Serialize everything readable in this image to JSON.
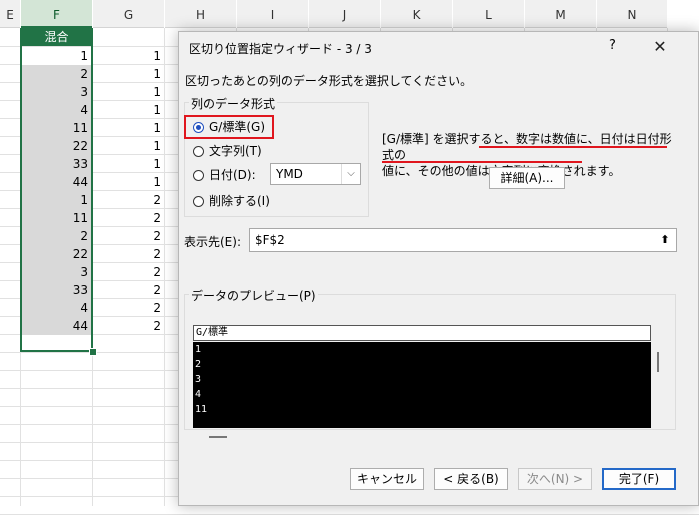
{
  "sheet": {
    "columns": [
      "E",
      "F",
      "G",
      "H",
      "I",
      "J",
      "K",
      "L",
      "M",
      "N"
    ],
    "f_header": "混合",
    "f_values": [
      "1",
      "2",
      "3",
      "4",
      "11",
      "22",
      "33",
      "44",
      "1",
      "11",
      "2",
      "22",
      "3",
      "33",
      "4",
      "44"
    ],
    "g_values": [
      "1",
      "1",
      "1",
      "1",
      "1",
      "1",
      "1",
      "1",
      "2",
      "2",
      "2",
      "2",
      "2",
      "2",
      "2",
      "2"
    ]
  },
  "dialog": {
    "title": "区切り位置指定ウィザード - 3 / 3",
    "help": "?",
    "close": "✕",
    "instruction": "区切ったあとの列のデータ形式を選択してください。",
    "format_group_label": "列のデータ形式",
    "options": [
      {
        "label": "G/標準(G)",
        "selected": true
      },
      {
        "label": "文字列(T)",
        "selected": false
      },
      {
        "label": "日付(D):",
        "selected": false
      },
      {
        "label": "削除する(I)",
        "selected": false
      }
    ],
    "date_format": "YMD",
    "description_line1": "[G/標準] を選択すると、数字は数値に、日付は日付形式の",
    "description_line2": "値に、その他の値は文字列に変換されます。",
    "advanced_button": "詳細(A)...",
    "destination_label": "表示先(E):",
    "destination_value": "$F$2",
    "preview_label": "データのプレビュー(P)",
    "preview_header": "G/標準",
    "preview_rows": [
      "1",
      "2",
      "3",
      "4",
      "11"
    ],
    "buttons": {
      "cancel": "キャンセル",
      "back": "< 戻る(B)",
      "next": "次へ(N) >",
      "finish": "完了(F)"
    },
    "colors": {
      "accent": "#2469c8",
      "highlight": "#e0161e",
      "sheet_selection": "#217346"
    }
  }
}
